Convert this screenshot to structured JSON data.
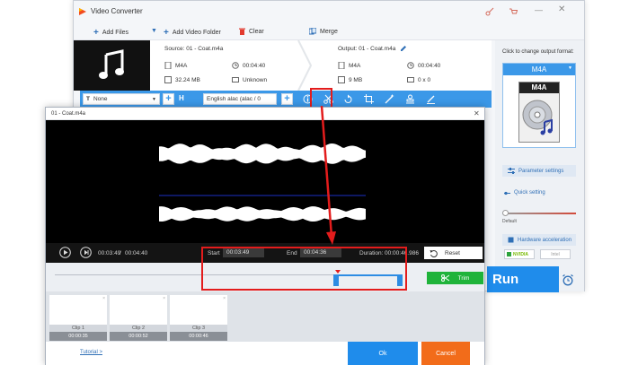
{
  "app": {
    "title": "Video Converter"
  },
  "toolbar": {
    "add_files": "Add Files",
    "add_folder": "Add Video Folder",
    "clear": "Clear",
    "merge": "Merge"
  },
  "file": {
    "source": "Source: 01 - Coat.m4a",
    "output": "Output: 01 - Coat.m4a",
    "src_format": "M4A",
    "src_duration": "00:04:40",
    "src_size": "32.24 MB",
    "src_res": "Unknown",
    "out_format": "M4A",
    "out_duration": "00:04:40",
    "out_size": "9 MB",
    "out_res": "0 x 0"
  },
  "bluebar": {
    "subtitle": "None",
    "audio": "English alac (alac / 0"
  },
  "right_panel": {
    "hint": "Click to change output format:",
    "format": "M4A",
    "param_settings": "Parameter settings",
    "quick_setting": "Quick setting",
    "slider_label": "Default",
    "hw_accel": "Hardware acceleration",
    "nvidia": "NVIDIA",
    "intel": "Intel",
    "run": "Run"
  },
  "dialog": {
    "title": "01 - Coat.m4a",
    "current_time": "00:03:49",
    "total_time": "00:04:40",
    "start_label": "Start",
    "start_value": "00:03:49",
    "end_label": "End",
    "end_value": "00:04:36",
    "duration_label": "Duration:",
    "duration_value": "00:00:46.986",
    "reset": "Reset",
    "trim": "Trim",
    "tutorial": "Tutorial >",
    "ok": "Ok",
    "cancel": "Cancel",
    "clips": [
      {
        "label": "Clip 1",
        "time": "00:00:35"
      },
      {
        "label": "Clip 2",
        "time": "00:00:52"
      },
      {
        "label": "Clip 3",
        "time": "00:00:46"
      }
    ]
  },
  "colors": {
    "accent": "#1f8ceb",
    "highlight": "#e31c1c",
    "trim_green": "#1fb33a",
    "cancel_orange": "#f26c1a"
  }
}
